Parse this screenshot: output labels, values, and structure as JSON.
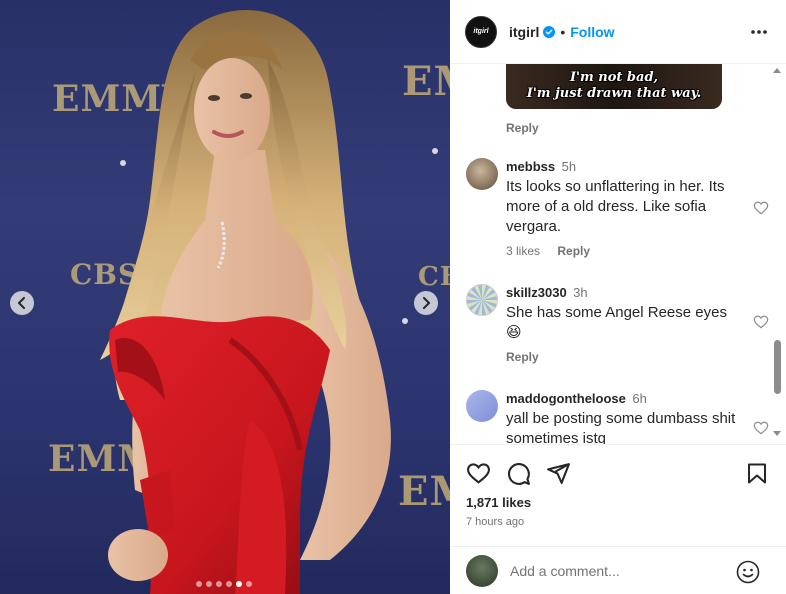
{
  "post": {
    "username": "itgirl",
    "avatar_text": "itgirl",
    "follow_label": "Follow",
    "separator": "•",
    "likes": "1,871 likes",
    "time": "7 hours ago"
  },
  "media": {
    "wall_text": [
      "EMMYS",
      "EMMYS",
      "EMMYS",
      "EMMYS",
      "CBS",
      "CBS"
    ],
    "carousel_dots": 6,
    "active_dot": 4
  },
  "meme": {
    "caption_line1": "I'm not bad,",
    "caption_line2": "I'm just drawn that way."
  },
  "comments": [
    {
      "username": "",
      "time": "",
      "text": "",
      "likes": "",
      "reply": "Reply"
    },
    {
      "username": "mebbss",
      "time": "5h",
      "text": "Its looks so unflattering in her. Its more of a old dress. Like sofia vergara.",
      "likes": "3 likes",
      "reply": "Reply"
    },
    {
      "username": "skillz3030",
      "time": "3h",
      "text": "She has some Angel Reese eyes 😆",
      "likes": "",
      "reply": "Reply"
    },
    {
      "username": "maddogontheloose",
      "time": "6h",
      "text": "yall be posting some dumbass shit sometimes istg",
      "likes": "",
      "reply": ""
    }
  ],
  "add_comment": {
    "placeholder": "Add a comment..."
  },
  "colors": {
    "accent": "#0095f6",
    "text": "#262626",
    "muted": "#737373",
    "dress": "#c8161e"
  },
  "icons": [
    "verified-badge-icon",
    "more-options-icon",
    "chevron-left-icon",
    "chevron-right-icon",
    "heart-icon",
    "comment-icon",
    "share-icon",
    "bookmark-icon",
    "emoji-icon"
  ]
}
